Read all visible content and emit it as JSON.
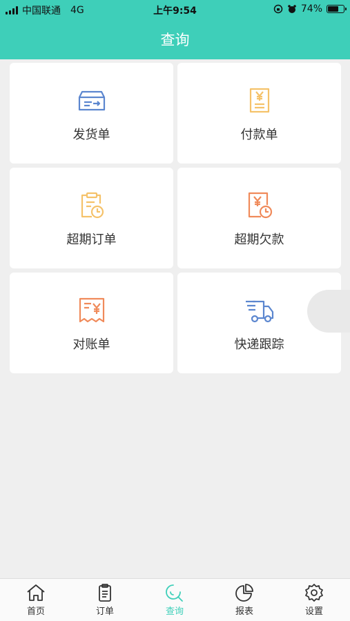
{
  "status_bar": {
    "carrier": "中国联通",
    "network": "4G",
    "time": "上午9:54",
    "battery": "74%",
    "battery_level": 0.74
  },
  "nav": {
    "title": "查询"
  },
  "cards": [
    {
      "label": "发货单",
      "icon": "shipping-box-icon",
      "color": "#5b86cf"
    },
    {
      "label": "付款单",
      "icon": "yuan-receipt-icon",
      "color": "#f5c26a"
    },
    {
      "label": "超期订单",
      "icon": "clipboard-clock-icon",
      "color": "#f5c26a"
    },
    {
      "label": "超期欠款",
      "icon": "yuan-clock-icon",
      "color": "#f08a5a"
    },
    {
      "label": "对账单",
      "icon": "statement-bill-icon",
      "color": "#f08a5a"
    },
    {
      "label": "快递跟踪",
      "icon": "delivery-truck-icon",
      "color": "#5b86cf"
    }
  ],
  "tabs": [
    {
      "label": "首页",
      "icon": "home-icon"
    },
    {
      "label": "订单",
      "icon": "clipboard-icon"
    },
    {
      "label": "查询",
      "icon": "search-icon",
      "active": true
    },
    {
      "label": "报表",
      "icon": "pie-chart-icon"
    },
    {
      "label": "设置",
      "icon": "gear-icon"
    }
  ],
  "colors": {
    "accent": "#3ecfb9",
    "background": "#efefef"
  }
}
